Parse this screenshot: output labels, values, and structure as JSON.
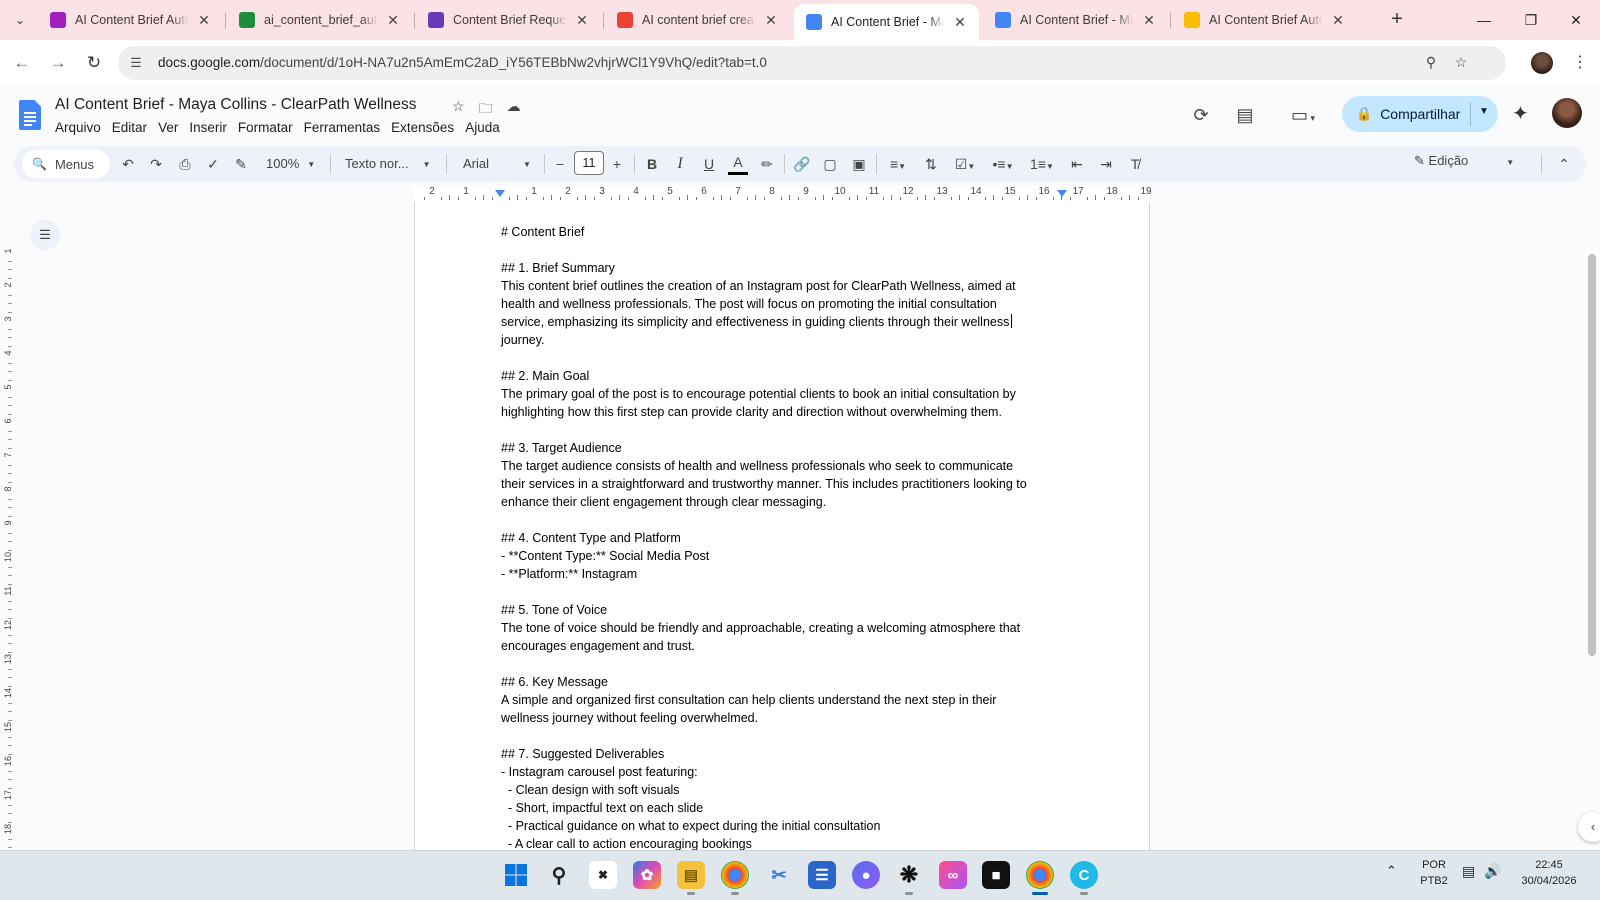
{
  "browser": {
    "tabs": [
      {
        "title": "AI Content Brief Auton",
        "favicon": "make-icon",
        "color": "#a01fbe"
      },
      {
        "title": "ai_content_brief_auton",
        "favicon": "sheets-icon",
        "color": "#1e8e3e"
      },
      {
        "title": "Content Brief Request I",
        "favicon": "forms-icon",
        "color": "#673ab7"
      },
      {
        "title": "AI content brief create",
        "favicon": "gmail-icon",
        "color": "#ea4335"
      },
      {
        "title": "AI Content Brief - May",
        "favicon": "docs-icon",
        "color": "#4285f4",
        "active": true
      },
      {
        "title": "AI Content Brief - May",
        "favicon": "docs-icon",
        "color": "#4285f4"
      },
      {
        "title": "AI Content Brief Autor",
        "favicon": "drive-icon",
        "color": "#fbbc04"
      }
    ],
    "url_host": "docs.google.com",
    "url_path": "/document/d/1oH-NA7u2n5AmEmC2aD_iY56TEBbNw2vhjrWCl1Y9VhQ/edit?tab=t.0"
  },
  "docs": {
    "title": "AI Content Brief - Maya Collins - ClearPath Wellness",
    "menu": [
      "Arquivo",
      "Editar",
      "Ver",
      "Inserir",
      "Formatar",
      "Ferramentas",
      "Extensões",
      "Ajuda"
    ],
    "share_label": "Compartilhar",
    "toolbar": {
      "menus_label": "Menus",
      "zoom": "100%",
      "style": "Texto nor...",
      "font": "Arial",
      "font_size": "11",
      "mode": "Edição"
    },
    "content": [
      "# Content Brief",
      "",
      "## 1. Brief Summary",
      "This content brief outlines the creation of an Instagram post for ClearPath Wellness, aimed at",
      "health and wellness professionals. The post will focus on promoting the initial consultation",
      "service, emphasizing its simplicity and effectiveness in guiding clients through their wellness",
      "journey.",
      "",
      "## 2. Main Goal",
      "The primary goal of the post is to encourage potential clients to book an initial consultation by",
      "highlighting how this first step can provide clarity and direction without overwhelming them.",
      "",
      "## 3. Target Audience",
      "The target audience consists of health and wellness professionals who seek to communicate",
      "their services in a straightforward and trustworthy manner. This includes practitioners looking to",
      "enhance their client engagement through clear messaging.",
      "",
      "## 4. Content Type and Platform",
      "- **Content Type:** Social Media Post",
      "- **Platform:** Instagram",
      "",
      "## 5. Tone of Voice",
      "The tone of voice should be friendly and approachable, creating a welcoming atmosphere that",
      "encourages engagement and trust.",
      "",
      "## 6. Key Message",
      "A simple and organized first consultation can help clients understand the next step in their",
      "wellness journey without feeling overwhelmed.",
      "",
      "## 7. Suggested Deliverables",
      "- Instagram carousel post featuring:",
      "  - Clean design with soft visuals",
      "  - Short, impactful text on each slide",
      "  - Practical guidance on what to expect during the initial consultation",
      "  - A clear call to action encouraging bookings"
    ],
    "ruler_numbers": [
      "2",
      "1",
      "",
      "1",
      "2",
      "3",
      "4",
      "5",
      "6",
      "7",
      "8",
      "9",
      "10",
      "11",
      "12",
      "13",
      "14",
      "15",
      "16",
      "17",
      "18",
      "19"
    ],
    "vruler_numbers": [
      "1",
      "2",
      "3",
      "4",
      "5",
      "6",
      "7",
      "8",
      "9",
      "10",
      "11",
      "12",
      "13",
      "14",
      "15",
      "16",
      "17",
      "18"
    ]
  },
  "system": {
    "lang_top": "POR",
    "lang_bottom": "PTB2",
    "time": "22:45",
    "date": "30/04/2026"
  },
  "colors": {
    "tabstrip": "#fbe2e6",
    "share_bg": "#c2e7ff",
    "toolbar_bg": "#edf2fa",
    "accent": "#4285f4"
  }
}
